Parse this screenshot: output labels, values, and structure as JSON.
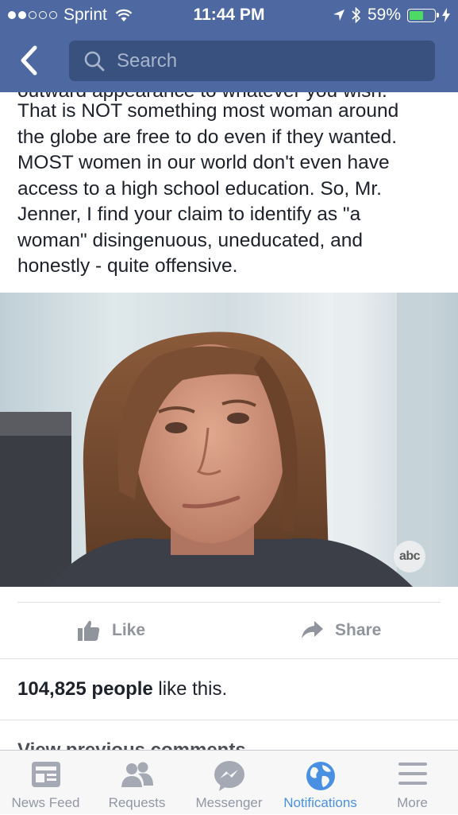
{
  "status_bar": {
    "carrier": "Sprint",
    "time": "11:44 PM",
    "battery": "59%",
    "battery_level": 0.59
  },
  "header": {
    "search_placeholder": "Search"
  },
  "post": {
    "lines": [
      "outward appearance to whatever you wish.",
      "That is NOT something most woman around",
      "the globe are free to do even if they wanted.",
      "MOST women in our world don't even have",
      "access to a high school education.  So, Mr.",
      "Jenner, I find your claim to identify as \"a",
      "woman\" disingenuous, uneducated, and",
      "honestly - quite offensive."
    ],
    "photo_watermark": "abc"
  },
  "actions": {
    "like_label": "Like",
    "share_label": "Share"
  },
  "likes": {
    "count_text": "104,825 people",
    "suffix": " like this."
  },
  "comments": {
    "view_previous": "View previous comments"
  },
  "tabbar": {
    "items": [
      {
        "label": "News Feed",
        "icon": "news-feed-icon",
        "active": false
      },
      {
        "label": "Requests",
        "icon": "friend-requests-icon",
        "active": false
      },
      {
        "label": "Messenger",
        "icon": "messenger-icon",
        "active": false
      },
      {
        "label": "Notifications",
        "icon": "globe-icon",
        "active": true
      },
      {
        "label": "More",
        "icon": "menu-icon",
        "active": false
      }
    ]
  },
  "colors": {
    "header_bg": "#4e69a2",
    "active_tab": "#4a90e2",
    "battery_green": "#4cd964"
  }
}
